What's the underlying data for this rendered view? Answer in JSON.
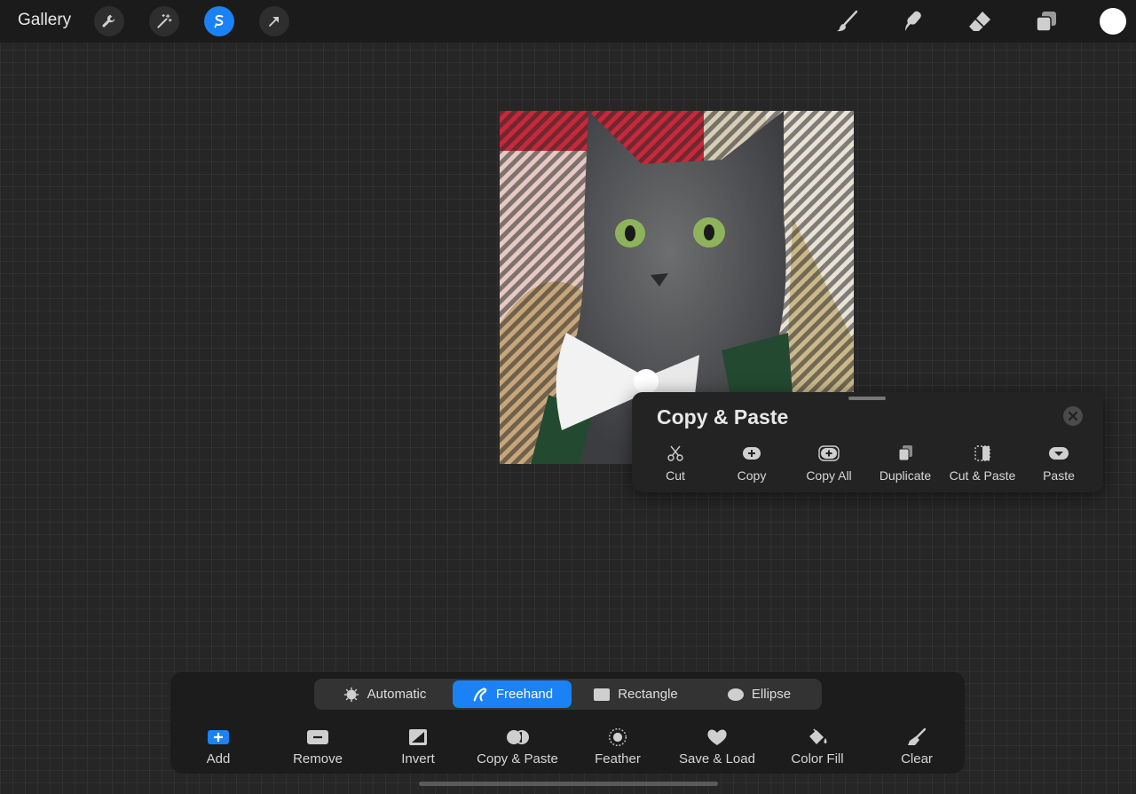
{
  "topbar": {
    "gallery_label": "Gallery",
    "left_tools": [
      {
        "name": "wrench-icon",
        "label": "Actions"
      },
      {
        "name": "magic-wand-icon",
        "label": "Adjustments"
      },
      {
        "name": "selection-icon",
        "label": "Selection",
        "active": true
      },
      {
        "name": "arrow-icon",
        "label": "Transform"
      }
    ],
    "right_tools": [
      "brush-icon",
      "smudge-icon",
      "eraser-icon",
      "layers-icon"
    ],
    "current_color": "#ffffff",
    "accent_color": "#1a82f5"
  },
  "canvas": {
    "image_subject": "gray cat with white bow tie"
  },
  "copy_paste_panel": {
    "title": "Copy & Paste",
    "actions": [
      {
        "label": "Cut",
        "icon": "scissors-icon"
      },
      {
        "label": "Copy",
        "icon": "copy-icon"
      },
      {
        "label": "Copy All",
        "icon": "copy-all-icon"
      },
      {
        "label": "Duplicate",
        "icon": "duplicate-icon"
      },
      {
        "label": "Cut & Paste",
        "icon": "cut-paste-icon"
      },
      {
        "label": "Paste",
        "icon": "paste-icon"
      }
    ]
  },
  "selection_toolbar": {
    "modes": [
      {
        "label": "Automatic",
        "icon": "automatic-icon",
        "active": false
      },
      {
        "label": "Freehand",
        "icon": "freehand-icon",
        "active": true
      },
      {
        "label": "Rectangle",
        "icon": "rectangle-icon",
        "active": false
      },
      {
        "label": "Ellipse",
        "icon": "ellipse-icon",
        "active": false
      }
    ],
    "actions": [
      {
        "label": "Add",
        "icon": "add-icon"
      },
      {
        "label": "Remove",
        "icon": "remove-icon"
      },
      {
        "label": "Invert",
        "icon": "invert-icon"
      },
      {
        "label": "Copy & Paste",
        "icon": "copy-paste-icon"
      },
      {
        "label": "Feather",
        "icon": "feather-icon"
      },
      {
        "label": "Save & Load",
        "icon": "save-load-icon"
      },
      {
        "label": "Color Fill",
        "icon": "color-fill-icon"
      },
      {
        "label": "Clear",
        "icon": "clear-icon"
      }
    ]
  }
}
